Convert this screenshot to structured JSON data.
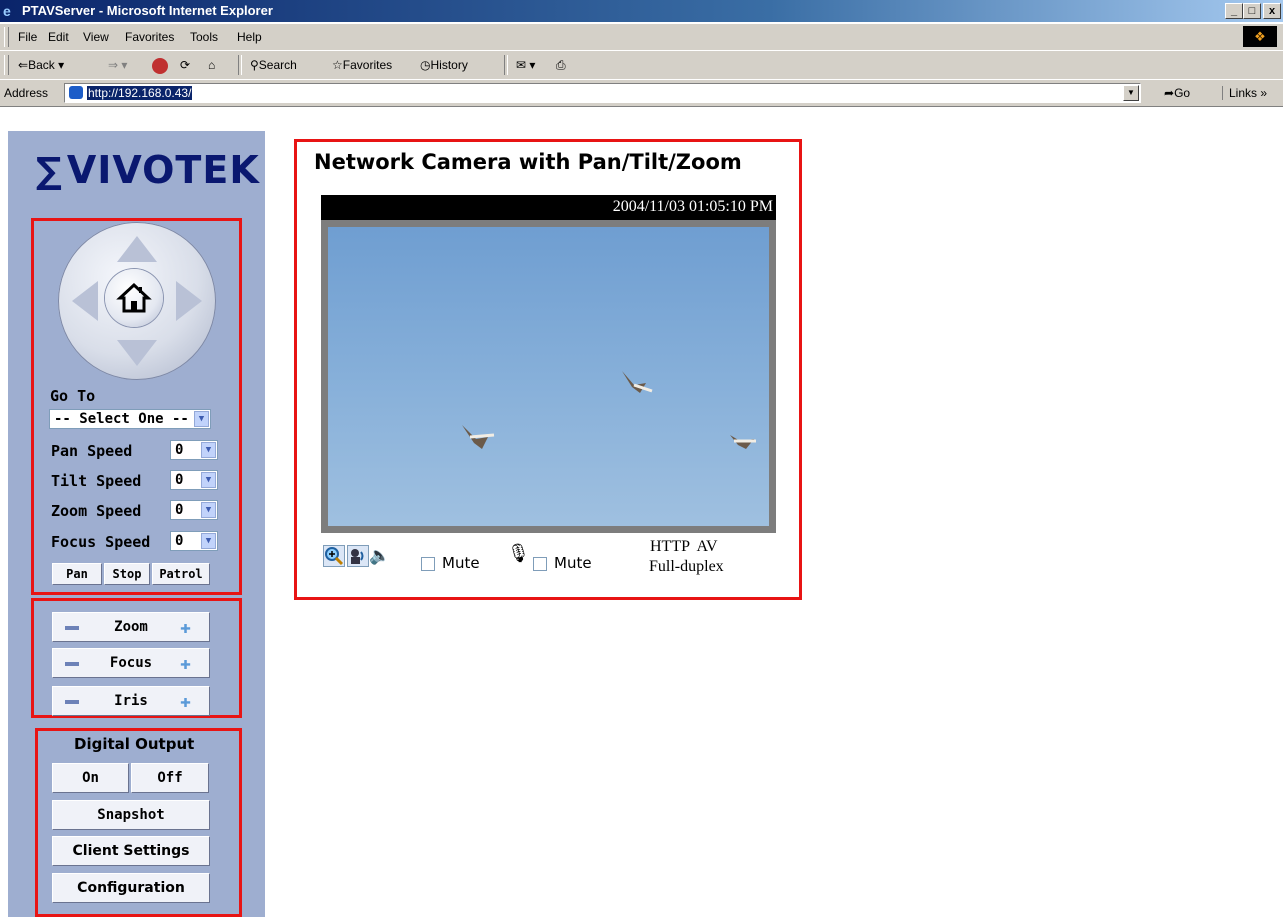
{
  "window": {
    "title": "PTAVServer - Microsoft Internet Explorer",
    "minimize": "_",
    "maximize": "&#x25A1;",
    "close": "x"
  },
  "menu": [
    "File",
    "Edit",
    "View",
    "Favorites",
    "Tools",
    "Help"
  ],
  "toolbar": {
    "back": "Back",
    "search": "Search",
    "favorites": "Favorites",
    "history": "History"
  },
  "address": {
    "label": "Address",
    "url": "http://192.168.0.43/",
    "go": "Go",
    "links": "Links"
  },
  "logo": "VIVOTEK",
  "ptz": {
    "goto_label": "Go To",
    "goto_value": "-- Select One --",
    "pan_speed_label": "Pan Speed",
    "pan_speed": "0",
    "tilt_speed_label": "Tilt Speed",
    "tilt_speed": "0",
    "zoom_speed_label": "Zoom Speed",
    "zoom_speed": "0",
    "focus_speed_label": "Focus Speed",
    "focus_speed": "0",
    "pan_btn": "Pan",
    "stop_btn": "Stop",
    "patrol_btn": "Patrol"
  },
  "lens": {
    "zoom": "Zoom",
    "focus": "Focus",
    "iris": "Iris"
  },
  "output": {
    "heading": "Digital Output",
    "on": "On",
    "off": "Off",
    "snapshot": "Snapshot",
    "client_settings": "Client Settings",
    "configuration": "Configuration"
  },
  "viewer": {
    "title": "Network Camera with Pan/Tilt/Zoom",
    "timestamp": "2004/11/03 01:05:10 PM",
    "mute1": "Mute",
    "mute2": "Mute",
    "protocol": "HTTP  AV",
    "duplex": "Full-duplex"
  },
  "colors": {
    "panel_bg": "#9eaed0",
    "highlight_box": "#e81414",
    "title_bar": "#0a246a"
  }
}
